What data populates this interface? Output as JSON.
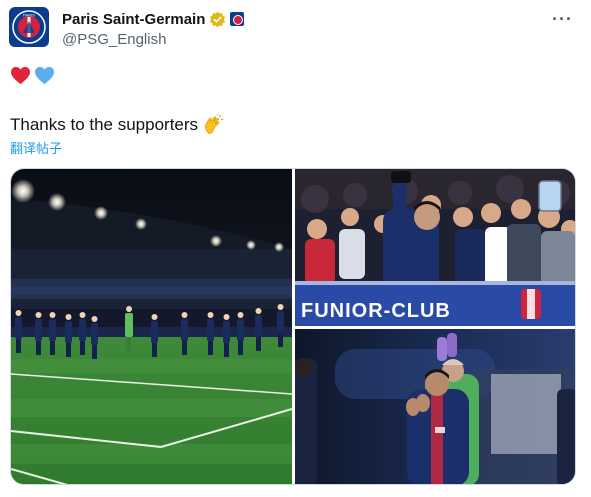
{
  "account": {
    "display_name": "Paris Saint-Germain",
    "handle": "@PSG_English",
    "avatar_icon": "psg-crest-icon",
    "verified_icon": "gold-verified-badge-icon",
    "affiliate_icon": "psg-affiliate-badge-icon"
  },
  "more_icon": "more-options-icon",
  "emojis": [
    "red-heart-icon",
    "blue-heart-icon"
  ],
  "tweet": {
    "text": "Thanks to the supporters",
    "trailing_emoji": "clapping-hands-icon",
    "translate_label": "翻译帖子"
  },
  "media": {
    "photos": [
      {
        "name": "team-applauding-stadium-photo",
        "banner_text": ""
      },
      {
        "name": "player-selfie-with-fans-photo",
        "banner_text": "FUNIOR-CLUB"
      },
      {
        "name": "players-applauding-closeup-photo",
        "banner_text": ""
      }
    ]
  },
  "colors": {
    "link": "#1d9bf0",
    "text": "#0f1419",
    "secondary": "#536471",
    "psg_blue": "#0a3d8f",
    "psg_red": "#d4213d",
    "verified_gold": "#e2b719"
  }
}
